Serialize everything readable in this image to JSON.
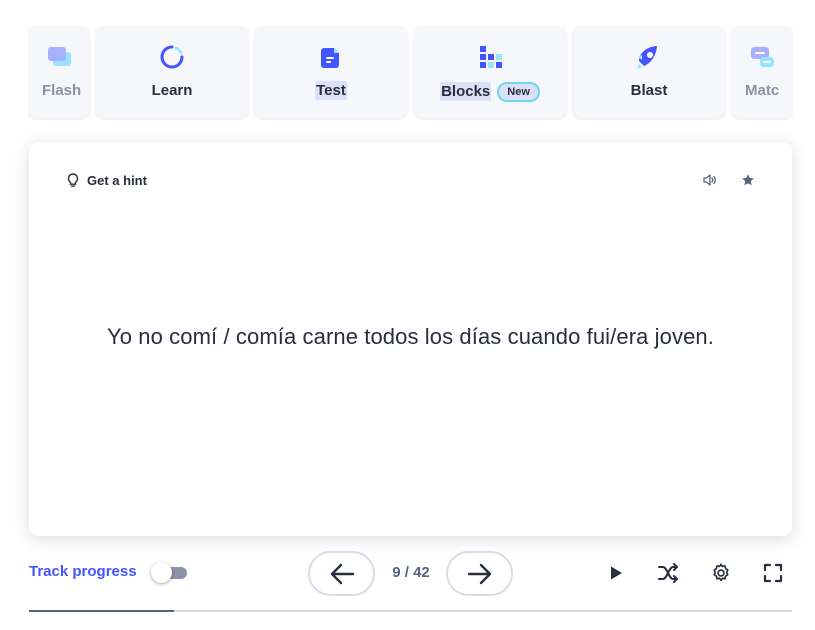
{
  "modes": [
    {
      "label": "Flash",
      "icon": "flashcards-icon"
    },
    {
      "label": "Learn",
      "icon": "learn-icon"
    },
    {
      "label": "Test",
      "icon": "test-icon"
    },
    {
      "label": "Blocks",
      "icon": "blocks-icon",
      "badge": "New"
    },
    {
      "label": "Blast",
      "icon": "blast-icon"
    },
    {
      "label": "Matc",
      "icon": "match-icon"
    }
  ],
  "card": {
    "hint_label": "Get a hint",
    "term": "Yo no comí / comía carne todos los días cuando fui/era joven."
  },
  "controls": {
    "track_progress_label": "Track progress",
    "track_progress_on": false,
    "counter": "9 / 42",
    "progress_fraction": 0.19
  },
  "colors": {
    "accent": "#4255ff",
    "text": "#282e3e",
    "muted": "#586380",
    "tile": "#f6f7fb",
    "badge_border": "#6fd6f2"
  }
}
